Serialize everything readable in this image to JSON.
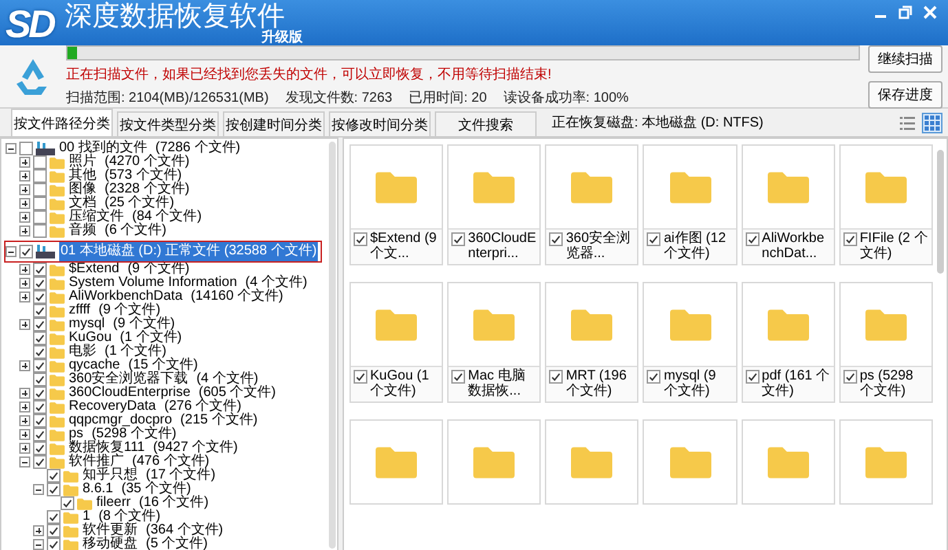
{
  "window": {
    "logo": "SD",
    "title": "深度数据恢复软件",
    "edition": "升级版"
  },
  "scan": {
    "level": 0.012,
    "message": "正在扫描文件，如果已经找到您丢失的文件，可以立即恢复，不用等待扫描结束!",
    "stats": [
      "扫描范围: 2104(MB)/126531(MB)",
      "发现文件数: 7263",
      "已用时间: 20",
      "读设备成功率: 100%"
    ],
    "buttons": [
      "继续扫描",
      "保存进度"
    ]
  },
  "tabs": [
    {
      "label": "按文件路径分类",
      "selected": true
    },
    {
      "label": "按文件类型分类",
      "selected": false
    },
    {
      "label": "按创建时间分类",
      "selected": false
    },
    {
      "label": "按修改时间分类",
      "selected": false
    },
    {
      "label": "文件搜索",
      "selected": false
    }
  ],
  "status": "正在恢复磁盘: 本地磁盘 (D: NTFS)",
  "view_modes": [
    {
      "kind": "list",
      "selected": false
    },
    {
      "kind": "grid",
      "selected": true
    }
  ],
  "tree": [
    {
      "kind": "drive",
      "name": "00 找到的文件",
      "count": "(7286 个文件)",
      "checked": false,
      "expanded": true,
      "selected": false,
      "children": [
        {
          "kind": "folder",
          "name": "照片",
          "count": "(4270 个文件)",
          "checked": false,
          "expanded": false
        },
        {
          "kind": "folder",
          "name": "其他",
          "count": "(573 个文件)",
          "checked": false,
          "expanded": false
        },
        {
          "kind": "folder",
          "name": "图像",
          "count": "(2328 个文件)",
          "checked": false,
          "expanded": false
        },
        {
          "kind": "folder",
          "name": "文档",
          "count": "(25 个文件)",
          "checked": false,
          "expanded": false
        },
        {
          "kind": "folder",
          "name": "压缩文件",
          "count": "(84 个文件)",
          "checked": false,
          "expanded": false
        },
        {
          "kind": "folder",
          "name": "音频",
          "count": "(6 个文件)",
          "checked": false,
          "expanded": false
        }
      ]
    },
    {
      "kind": "drive",
      "name": "01 本地磁盘 (D:) 正常文件 (32588 个文件)",
      "checked": true,
      "expanded": true,
      "selected": true,
      "children": [
        {
          "kind": "folder",
          "name": "$Extend",
          "count": "(9 个文件)",
          "checked": true,
          "expanded": false
        },
        {
          "kind": "folder",
          "name": "System Volume Information",
          "count": "(4 个文件)",
          "checked": true,
          "expanded": false
        },
        {
          "kind": "folder",
          "name": "AliWorkbenchData",
          "count": "(14160 个文件)",
          "checked": true,
          "expanded": false
        },
        {
          "kind": "folder",
          "name": "zffff",
          "count": "(9 个文件)",
          "checked": true
        },
        {
          "kind": "folder",
          "name": "mysql",
          "count": "(9 个文件)",
          "checked": true,
          "expanded": false
        },
        {
          "kind": "folder",
          "name": "KuGou",
          "count": "(1 个文件)",
          "checked": true
        },
        {
          "kind": "folder",
          "name": "电影",
          "count": "(1 个文件)",
          "checked": true
        },
        {
          "kind": "folder",
          "name": "qycache",
          "count": "(15 个文件)",
          "checked": true,
          "expanded": false
        },
        {
          "kind": "folder",
          "name": "360安全浏览器下载",
          "count": "(4 个文件)",
          "checked": true
        },
        {
          "kind": "folder",
          "name": "360CloudEnterprise",
          "count": "(605 个文件)",
          "checked": true,
          "expanded": false
        },
        {
          "kind": "folder",
          "name": "RecoveryData",
          "count": "(276 个文件)",
          "checked": true,
          "expanded": false
        },
        {
          "kind": "folder",
          "name": "qqpcmgr_docpro",
          "count": "(215 个文件)",
          "checked": true,
          "expanded": false
        },
        {
          "kind": "folder",
          "name": "ps",
          "count": "(5298 个文件)",
          "checked": true,
          "expanded": false
        },
        {
          "kind": "folder",
          "name": "数据恢复111",
          "count": "(9427 个文件)",
          "checked": true,
          "expanded": false
        },
        {
          "kind": "folder",
          "name": "软件推广",
          "count": "(476 个文件)",
          "checked": true,
          "expanded": true,
          "children": [
            {
              "kind": "folder",
              "name": "知乎只想",
              "count": "(17 个文件)",
              "checked": true
            },
            {
              "kind": "folder",
              "name": "8.6.1",
              "count": "(35 个文件)",
              "checked": true,
              "expanded": true,
              "children": [
                {
                  "kind": "folder",
                  "name": "fileerr",
                  "count": "(16 个文件)",
                  "checked": true
                }
              ]
            },
            {
              "kind": "folder",
              "name": "1",
              "count": "(8 个文件)",
              "checked": true
            },
            {
              "kind": "folder",
              "name": "软件更新",
              "count": "(364 个文件)",
              "checked": true,
              "expanded": false
            },
            {
              "kind": "folder",
              "name": "移动硬盘",
              "count": "(5 个文件)",
              "checked": true,
              "expanded": true
            }
          ]
        }
      ]
    }
  ],
  "grid": [
    {
      "kind": "folder",
      "label": "$Extend (9 个文...",
      "checked": true
    },
    {
      "kind": "folder",
      "label": "360CloudEnterpri...",
      "checked": true
    },
    {
      "kind": "folder",
      "label": "360安全浏览器...",
      "checked": true
    },
    {
      "kind": "folder",
      "label": "ai作图 (12 个文件)",
      "checked": true
    },
    {
      "kind": "folder",
      "label": "AliWorkbenchDat...",
      "checked": true
    },
    {
      "kind": "folder",
      "label": "FIFile (2 个文件)",
      "checked": true
    },
    {
      "kind": "folder",
      "label": "KuGou (1 个文件)",
      "checked": true
    },
    {
      "kind": "folder",
      "label": "Mac 电脑数据恢...",
      "checked": true
    },
    {
      "kind": "folder",
      "label": "MRT (196 个文件)",
      "checked": true
    },
    {
      "kind": "folder",
      "label": "mysql (9 个文件)",
      "checked": true
    },
    {
      "kind": "folder",
      "label": "pdf (161 个文件)",
      "checked": true
    },
    {
      "kind": "folder",
      "label": "ps (5298 个文件)",
      "checked": true
    },
    {
      "kind": "folder"
    },
    {
      "kind": "folder"
    },
    {
      "kind": "folder"
    },
    {
      "kind": "folder"
    },
    {
      "kind": "folder"
    },
    {
      "kind": "folder"
    }
  ]
}
